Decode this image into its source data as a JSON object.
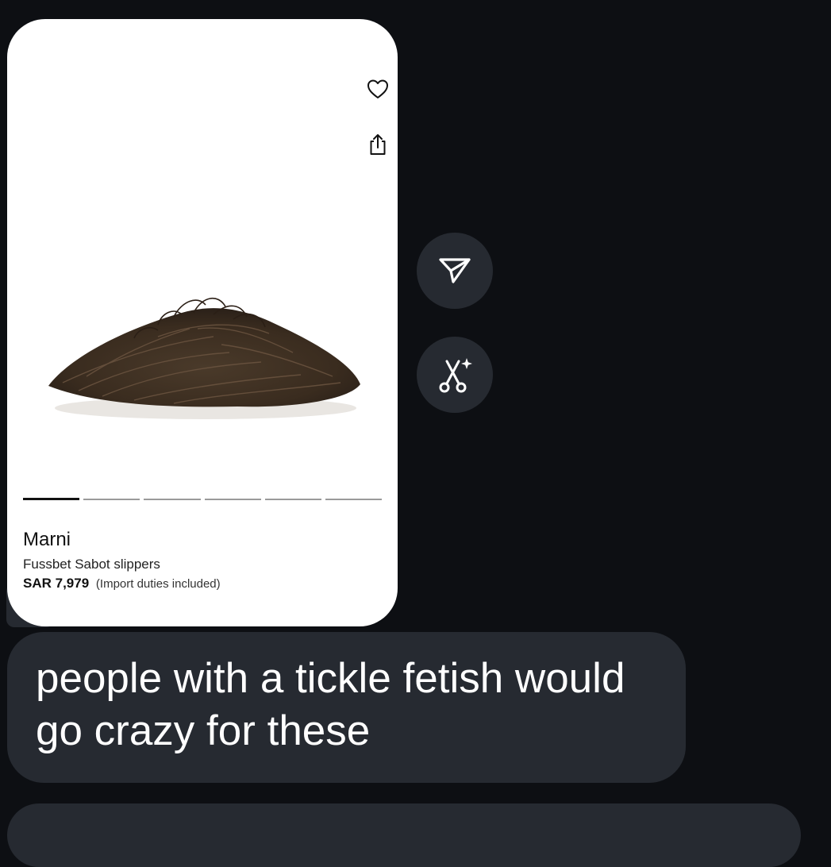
{
  "product": {
    "brand": "Marni",
    "name": "Fussbet Sabot slippers",
    "price": "SAR 7,979",
    "price_note": "(Import duties included)",
    "image_count": 6,
    "active_image_index": 0
  },
  "icons": {
    "favorite": "heart-icon",
    "share": "share-icon",
    "send": "send-icon",
    "remix": "remix-sparkle-icon"
  },
  "message": {
    "text": "people with a tickle fetish would go crazy for these"
  },
  "colors": {
    "background": "#0d0f13",
    "bubble": "#262a31",
    "card": "#ffffff",
    "text": "#ffffff"
  }
}
